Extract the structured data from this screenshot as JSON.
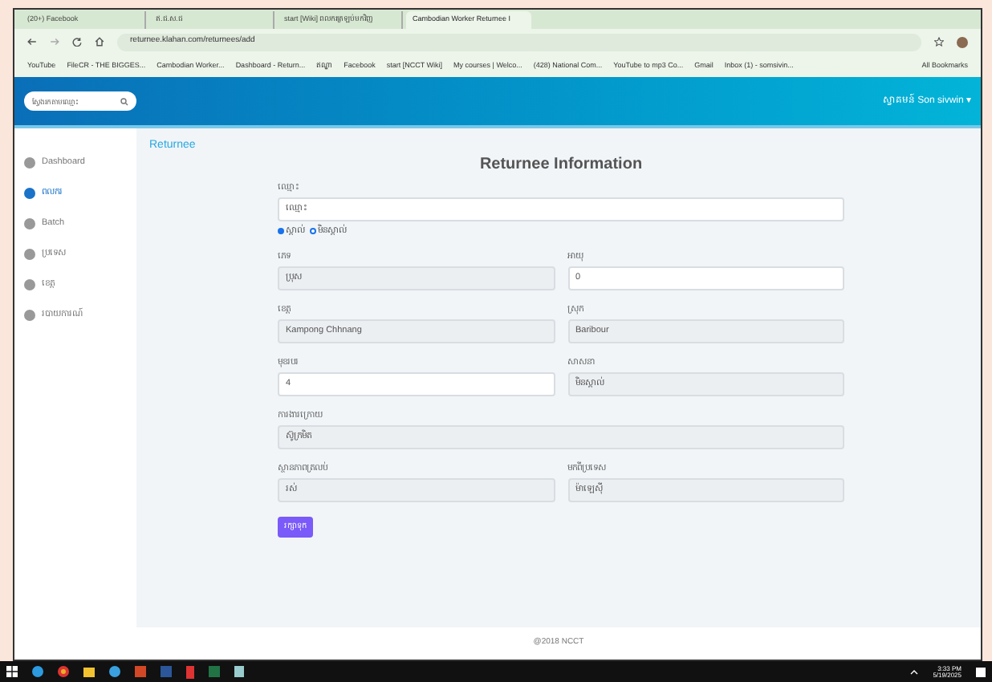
{
  "browser": {
    "tabs": [
      {
        "label": "(20+) Facebook",
        "selected": false
      },
      {
        "label": "ឥ.ជ.ស.ជ",
        "selected": false
      },
      {
        "label": "start [Wiki] ពលករត្រឡប់មកវិញ",
        "selected": false
      },
      {
        "label": "Cambodian Worker Returnee I",
        "selected": true
      }
    ],
    "address": "returnee.klahan.com/returnees/add",
    "bookmarks": [
      "YouTube",
      "FileCR - THE BIGGES...",
      "Cambodian Worker...",
      "Dashboard - Return...",
      "ឥណ្ឌា",
      "Facebook",
      "start [NCCT Wiki]",
      "My courses | Welco...",
      "(428) National Com...",
      "YouTube to mp3 Co...",
      "Gmail",
      "Inbox (1) - somsivin..."
    ],
    "all_bookmarks": "All Bookmarks"
  },
  "header": {
    "search": {
      "placeholder": "ស្វែងរកតាមឈ្មោះ"
    },
    "user": "ស្វាគមន៍ Son sivwin ▾"
  },
  "sidebar": {
    "items": [
      {
        "label": "Dashboard",
        "selected": false
      },
      {
        "label": "ពលករ",
        "selected": true
      },
      {
        "label": "Batch",
        "selected": false
      },
      {
        "label": "ប្រទេស",
        "selected": false
      },
      {
        "label": "ខេត្ត",
        "selected": false
      },
      {
        "label": "របាយការណ៍",
        "selected": false
      }
    ]
  },
  "breadcrumb": "Returnee",
  "form": {
    "title": "Returnee Information",
    "rows": [
      {
        "fields": [
          {
            "label": "ឈ្មោះ",
            "value": "ឈ្មោះ",
            "editable": true
          }
        ],
        "options": [
          {
            "label": "ស្គាល់",
            "selected": true
          },
          {
            "label": "មិនស្គាល់",
            "selected": false
          }
        ]
      },
      {
        "fields": [
          {
            "label": "ភេទ",
            "value": "ប្រុស",
            "editable": false
          },
          {
            "label": "អាយុ",
            "value": "0",
            "editable": true
          }
        ]
      },
      {
        "fields": [
          {
            "label": "ខេត្ត",
            "value": "Kampong Chhnang",
            "editable": false
          },
          {
            "label": "ស្រុក",
            "value": "Baribour",
            "editable": false
          }
        ]
      },
      {
        "fields": [
          {
            "label": "មុខរបរ",
            "value": "4",
            "editable": true
          },
          {
            "label": "សាសនា",
            "value": "មិនស្គាល់",
            "editable": false
          }
        ]
      },
      {
        "fields": [
          {
            "label": "ការងារក្រោយ",
            "value": "ស៊ូក្រមិត",
            "editable": false
          }
        ]
      },
      {
        "fields": [
          {
            "label": "ស្ថានភាពត្រលប់",
            "value": "រស់",
            "editable": false
          },
          {
            "label": "មកពីប្រទេស",
            "value": "ម៉ាឡេស៊ី",
            "editable": false
          }
        ]
      }
    ],
    "submit": "រក្សាទុក"
  },
  "footer": "@2018 NCCT",
  "taskbar": {
    "time": "3:33 PM",
    "date": "5/19/2025"
  }
}
